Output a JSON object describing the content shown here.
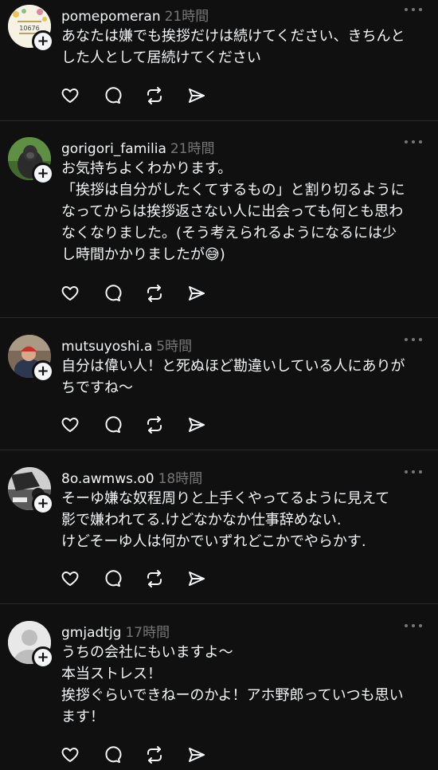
{
  "posts": [
    {
      "username": "pomepomeran",
      "timestamp": "21時間",
      "avatar_icon": "pomeranian-dog-image",
      "avatar_text_1": "10676",
      "lines": [
        "あなたは嫌でも挨拶だけは続けてください、きちんと",
        "した人として居続けてください"
      ]
    },
    {
      "username": "gorigori_familia",
      "timestamp": "21時間",
      "avatar_icon": "gorilla-image",
      "lines": [
        "お気持ちよくわかります。",
        "「挨拶は自分がしたくてするもの」と割り切るように",
        "なってからは挨拶返さない人に出会っても何とも思わ",
        "なくなりました。(そう考えられるようになるには少",
        "し時間かかりましたが😅)"
      ]
    },
    {
      "username": "mutsuyoshi.a",
      "timestamp": "5時間",
      "avatar_icon": "person-helmet-image",
      "lines": [
        "自分は偉い人！と死ぬほど勘違いしている人にありが",
        "ちですね〜"
      ]
    },
    {
      "username": "8o.awmws.o0",
      "timestamp": "18時間",
      "avatar_icon": "monochrome-photo-image",
      "lines": [
        "そーゆ嫌な奴程周りと上手くやってるように見えて",
        "影で嫌われてる.けどなかなか仕事辞めない.",
        "けどそーゆ人は何かでいずれどこかでやらかす."
      ]
    },
    {
      "username": "gmjadtjg",
      "timestamp": "17時間",
      "avatar_icon": "default-profile-icon",
      "lines": [
        "うちの会社にもいますよ〜",
        "本当ストレス！",
        "挨拶ぐらいできねーのかよ！アホ野郎っていつも思い",
        "ます！"
      ]
    }
  ],
  "follow_badge_symbol": "+",
  "colors": {
    "background": "#101010",
    "text": "#f3f5f7",
    "muted": "#777777",
    "divider": "#2a2a2a"
  },
  "action_icons": [
    "heart-icon",
    "comment-icon",
    "repost-icon",
    "share-icon"
  ]
}
